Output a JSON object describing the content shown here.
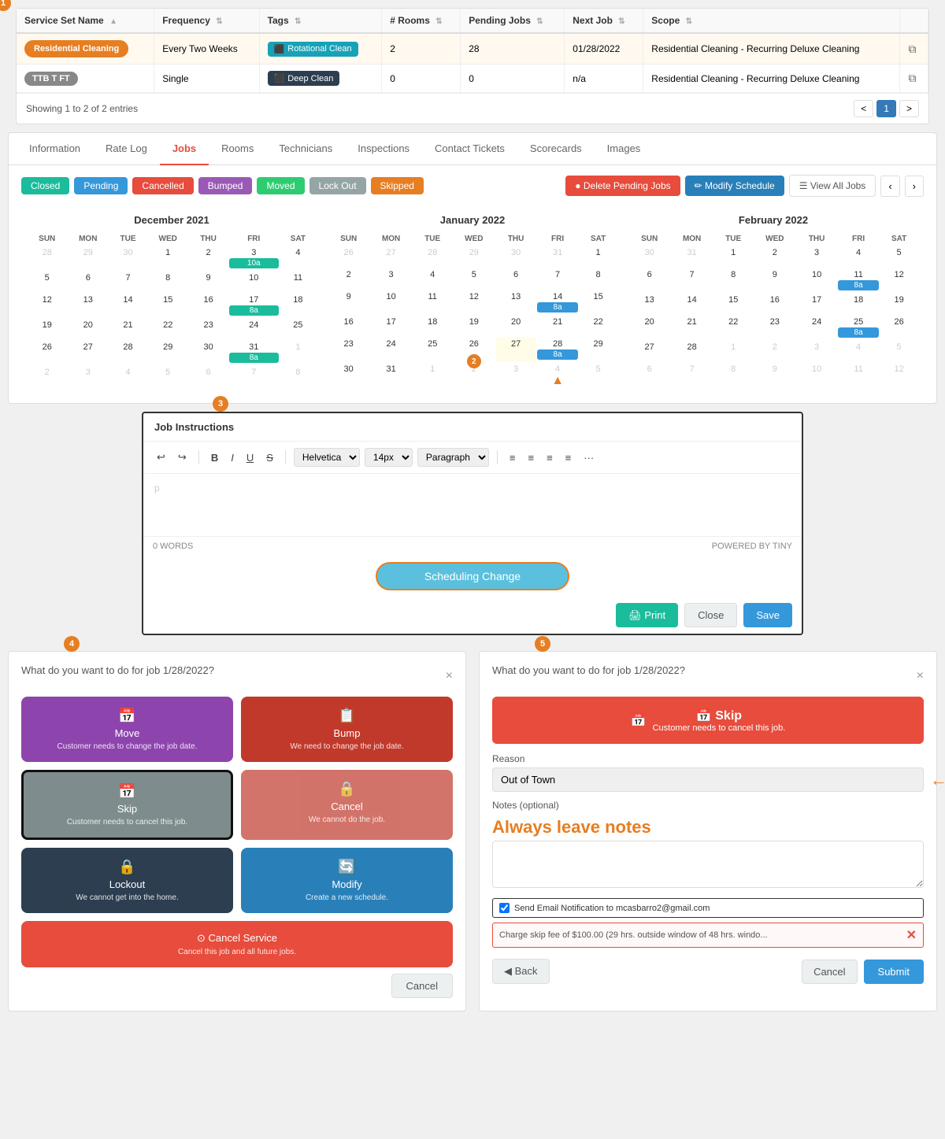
{
  "table": {
    "columns": [
      {
        "label": "Service Set Name",
        "sort": true
      },
      {
        "label": "Frequency",
        "sort": true
      },
      {
        "label": "Tags",
        "sort": true
      },
      {
        "label": "# Rooms",
        "sort": true
      },
      {
        "label": "Pending Jobs",
        "sort": true
      },
      {
        "label": "Next Job",
        "sort": true
      },
      {
        "label": "Scope",
        "sort": true
      },
      {
        "label": "",
        "sort": false
      }
    ],
    "rows": [
      {
        "service_set_name": "Residential Cleaning",
        "service_name_pill_class": "pill-orange",
        "frequency": "Every Two Weeks",
        "tag_label": "Rotational Clean",
        "tag_class": "tag-teal",
        "rooms": "2",
        "pending": "28",
        "next_job": "01/28/2022",
        "scope": "Residential Cleaning - Recurring Deluxe Cleaning",
        "selected": true
      },
      {
        "service_set_name": "TTB T FT",
        "service_name_pill_class": "pill-gray",
        "frequency": "Single",
        "tag_label": "Deep Clean",
        "tag_class": "tag-navy",
        "rooms": "0",
        "pending": "0",
        "next_job": "n/a",
        "scope": "Residential Cleaning - Recurring Deluxe Cleaning",
        "selected": false
      }
    ],
    "showing": "Showing 1 to 2 of 2 entries",
    "pagination": {
      "current": 1,
      "prev": "<",
      "next": ">"
    }
  },
  "tabs": {
    "items": [
      {
        "label": "Information",
        "active": false
      },
      {
        "label": "Rate Log",
        "active": false
      },
      {
        "label": "Jobs",
        "active": true
      },
      {
        "label": "Rooms",
        "active": false
      },
      {
        "label": "Technicians",
        "active": false
      },
      {
        "label": "Inspections",
        "active": false
      },
      {
        "label": "Contact Tickets",
        "active": false
      },
      {
        "label": "Scorecards",
        "active": false
      },
      {
        "label": "Images",
        "active": false
      }
    ]
  },
  "status_badges": [
    {
      "label": "Closed",
      "class": "s-closed"
    },
    {
      "label": "Pending",
      "class": "s-pending"
    },
    {
      "label": "Cancelled",
      "class": "s-cancelled"
    },
    {
      "label": "Bumped",
      "class": "s-bumped"
    },
    {
      "label": "Moved",
      "class": "s-moved"
    },
    {
      "label": "Lock Out",
      "class": "s-lockout"
    },
    {
      "label": "Skipped",
      "class": "s-skipped"
    }
  ],
  "action_buttons": {
    "delete": "● Delete Pending Jobs",
    "modify": "✏ Modify Schedule",
    "view": "☰ View All Jobs"
  },
  "calendars": [
    {
      "title": "December 2021",
      "days": [
        "SUN",
        "MON",
        "TUE",
        "WED",
        "THU",
        "FRI",
        "SAT"
      ],
      "weeks": [
        [
          "28",
          "29",
          "30",
          "1",
          "2",
          "3",
          "4"
        ],
        [
          "5",
          "6",
          "7",
          "8",
          "9",
          "10",
          "11"
        ],
        [
          "12",
          "13",
          "14",
          "15",
          "16",
          "17",
          "18"
        ],
        [
          "19",
          "20",
          "21",
          "22",
          "23",
          "24",
          "25"
        ],
        [
          "26",
          "27",
          "28",
          "29",
          "30",
          "31",
          "1"
        ],
        [
          "2",
          "3",
          "4",
          "5",
          "6",
          "7",
          "8"
        ]
      ],
      "events": [
        {
          "week": 0,
          "day": 5,
          "label": "10a",
          "class": "cal-event"
        }
      ],
      "other_month_start": 3,
      "other_month_end_week": 4
    },
    {
      "title": "January 2022",
      "days": [
        "SUN",
        "MON",
        "TUE",
        "WED",
        "THU",
        "FRI",
        "SAT"
      ],
      "weeks": [
        [
          "26",
          "27",
          "28",
          "29",
          "30",
          "31",
          "1"
        ],
        [
          "2",
          "3",
          "4",
          "5",
          "6",
          "7",
          "8"
        ],
        [
          "9",
          "10",
          "11",
          "12",
          "13",
          "14",
          "15"
        ],
        [
          "16",
          "17",
          "18",
          "19",
          "20",
          "21",
          "22"
        ],
        [
          "23",
          "24",
          "25",
          "26",
          "27",
          "28",
          "29"
        ],
        [
          "30",
          "31",
          "1",
          "2",
          "3",
          "4",
          "5"
        ]
      ],
      "events": [
        {
          "week": 2,
          "day": 5,
          "label": "8a",
          "class": "cal-event cal-event-blue"
        },
        {
          "week": 4,
          "day": 5,
          "label": "8a",
          "class": "cal-event cal-event-blue"
        }
      ],
      "marker_2": {
        "week": 5,
        "day": 3
      },
      "arrow_up": {
        "week": 5,
        "day": 3
      }
    },
    {
      "title": "February 2022",
      "days": [
        "SUN",
        "MON",
        "TUE",
        "WED",
        "THU",
        "FRI",
        "SAT"
      ],
      "weeks": [
        [
          "30",
          "31",
          "1",
          "2",
          "3",
          "4",
          "5"
        ],
        [
          "6",
          "7",
          "8",
          "9",
          "10",
          "11",
          "12"
        ],
        [
          "13",
          "14",
          "15",
          "16",
          "17",
          "18",
          "19"
        ],
        [
          "20",
          "21",
          "22",
          "23",
          "24",
          "25",
          "26"
        ],
        [
          "27",
          "28",
          "1",
          "2",
          "3",
          "4",
          "5"
        ],
        [
          "6",
          "7",
          "8",
          "9",
          "10",
          "11",
          "12"
        ]
      ],
      "events": [
        {
          "week": 1,
          "day": 6,
          "label": "8a",
          "class": "cal-event cal-event-blue"
        },
        {
          "week": 3,
          "day": 6,
          "label": "8a",
          "class": "cal-event cal-event-blue"
        }
      ]
    }
  ],
  "job_instructions": {
    "title": "Job Instructions",
    "toolbar": {
      "font": "Helvetica",
      "size": "14px",
      "style": "Paragraph"
    },
    "word_count": "0 WORDS",
    "powered_by": "POWERED BY TINY",
    "scheduling_change_label": "Scheduling Change",
    "btn_print": "🖨 Print",
    "btn_close": "Close",
    "btn_save": "Save"
  },
  "left_panel": {
    "title": "What do you want to do for job 1/28/2022?",
    "close_x": "×",
    "actions": [
      {
        "label": "Move",
        "sub": "Customer needs to change the job date.",
        "icon": "📅",
        "class": "btn-move"
      },
      {
        "label": "Bump",
        "sub": "We need to change the job date.",
        "icon": "📋",
        "class": "btn-bump"
      },
      {
        "label": "Skip",
        "sub": "Customer needs to cancel this job.",
        "icon": "📅",
        "class": "btn-skip"
      },
      {
        "label": "Cancel",
        "sub": "We cannot do the job.",
        "icon": "🔒",
        "class": "btn-cancel-job"
      },
      {
        "label": "Lockout",
        "sub": "We cannot get into the home.",
        "icon": "🔒",
        "class": "btn-lockout"
      },
      {
        "label": "Modify",
        "sub": "Create a new schedule.",
        "icon": "🔄",
        "class": "btn-modify"
      }
    ],
    "cancel_service": {
      "label": "⊙ Cancel Service",
      "sub": "Cancel this job and all future jobs."
    },
    "btn_cancel": "Cancel"
  },
  "right_panel": {
    "title": "What do you want to do for job 1/28/2022?",
    "close_x": "×",
    "skip_label": "📅 Skip",
    "skip_sub": "Customer needs to cancel this job.",
    "reason_label": "Reason",
    "reason_value": "Out of Town",
    "notes_label": "Notes (optional)",
    "always_notes": "Always leave notes",
    "email_label": "Send Email Notification to mcasbarro2@gmail.com",
    "charge_label": "Charge skip fee of $100.00 (29 hrs. outside window of 48 hrs. windo...",
    "btn_back": "◀ Back",
    "btn_cancel": "Cancel",
    "btn_submit": "Submit"
  },
  "badge_labels": {
    "one": "1",
    "two": "2",
    "three": "3",
    "four": "4",
    "five": "5"
  }
}
